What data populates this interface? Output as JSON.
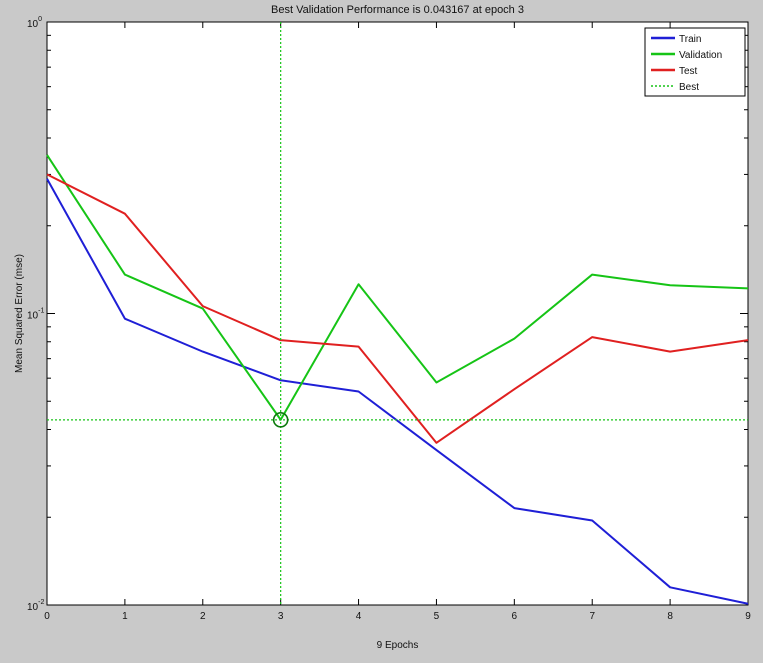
{
  "chart_data": {
    "type": "line",
    "title": "Best Validation Performance is 0.043167 at epoch 3",
    "xlabel": "9 Epochs",
    "ylabel": "Mean Squared Error  (mse)",
    "xlim": [
      0,
      9
    ],
    "ylim": [
      0.01,
      1
    ],
    "yscale": "log",
    "grid": false,
    "legend_position": "top-right",
    "x": [
      0,
      1,
      2,
      3,
      4,
      5,
      6,
      7,
      8,
      9
    ],
    "x_ticks": [
      "0",
      "1",
      "2",
      "3",
      "4",
      "5",
      "6",
      "7",
      "8",
      "9"
    ],
    "y_ticks": [
      {
        "value": 1,
        "base": "10",
        "exp": "0"
      },
      {
        "value": 0.1,
        "base": "10",
        "exp": "-1"
      },
      {
        "value": 0.01,
        "base": "10",
        "exp": "-2"
      }
    ],
    "series": [
      {
        "name": "Train",
        "color": "#1f1fd6",
        "values": [
          0.29,
          0.096,
          0.074,
          0.059,
          0.054,
          0.034,
          0.0215,
          0.0195,
          0.0115,
          0.0101
        ]
      },
      {
        "name": "Validation",
        "color": "#16c416",
        "values": [
          0.35,
          0.136,
          0.104,
          0.0432,
          0.126,
          0.058,
          0.082,
          0.136,
          0.125,
          0.122
        ]
      },
      {
        "name": "Test",
        "color": "#e02020",
        "values": [
          0.3,
          0.22,
          0.106,
          0.081,
          0.077,
          0.036,
          0.055,
          0.083,
          0.074,
          0.081
        ]
      }
    ],
    "best": {
      "name": "Best",
      "color": "#16c416",
      "epoch": 3,
      "value": 0.043167
    }
  }
}
